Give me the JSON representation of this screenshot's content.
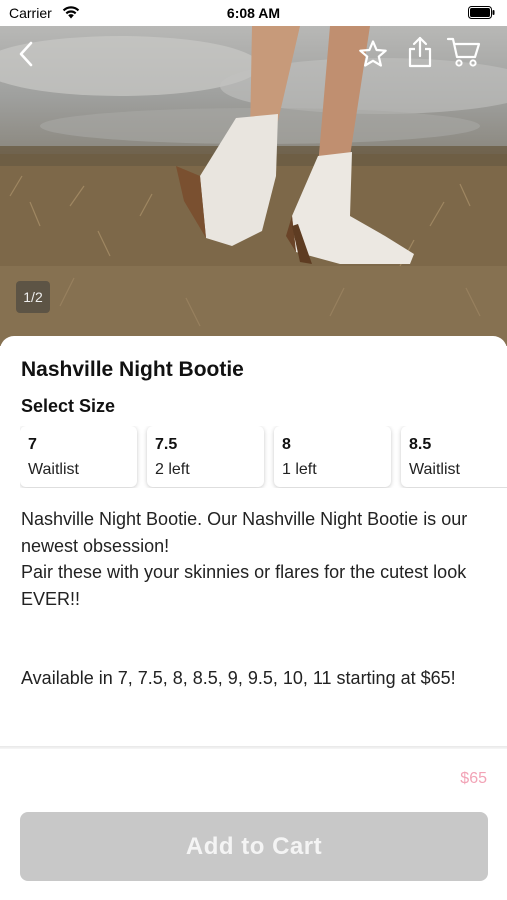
{
  "status_bar": {
    "carrier": "Carrier",
    "time": "6:08 AM"
  },
  "hero": {
    "image_counter": "1/2",
    "icons": [
      "chevron-left-icon",
      "star-icon",
      "share-icon",
      "cart-icon"
    ]
  },
  "product": {
    "title": "Nashville Night Bootie",
    "select_size_label": "Select Size",
    "sizes": [
      {
        "size": "7",
        "status": "Waitlist"
      },
      {
        "size": "7.5",
        "status": "2 left"
      },
      {
        "size": "8",
        "status": "1 left"
      },
      {
        "size": "8.5",
        "status": "Waitlist"
      }
    ],
    "description": "Nashville Night Bootie. Our Nashville Night Bootie is our newest obsession!\nPair these with your skinnies or flares for the cutest look EVER!!",
    "availability": "Available in 7, 7.5, 8, 8.5, 9, 9.5, 10, 11 starting at $65!"
  },
  "footer": {
    "price": "$65",
    "add_to_cart_label": "Add to Cart"
  },
  "colors": {
    "price": "#f2a3b6",
    "button_disabled": "#c8c8c8"
  }
}
